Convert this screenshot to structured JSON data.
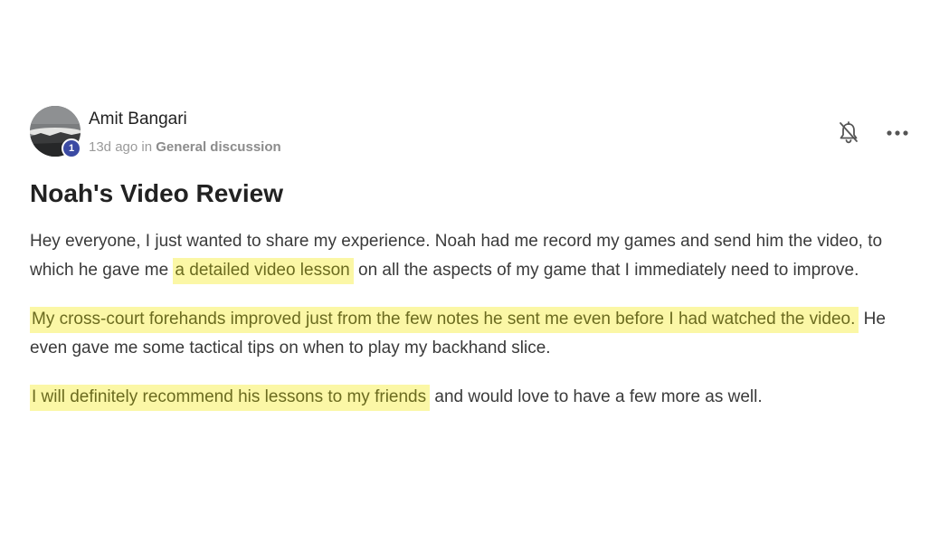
{
  "post": {
    "author": "Amit Bangari",
    "badge_count": "1",
    "time_ago": "13d ago",
    "in_text": "in",
    "category": "General discussion",
    "title": "Noah's Video Review",
    "paragraph1": {
      "part1": "Hey everyone, I just wanted to share my experience. Noah had me record my games and send him the video, to which he gave me ",
      "highlight": "a detailed video lesson",
      "part2": " on all the aspects of my game that I immediately need to improve."
    },
    "paragraph2": {
      "highlight": "My cross-court forehands improved just from the few notes he sent me even before I had watched the video.",
      "part2": " He even gave me some tactical tips on when to play my backhand slice."
    },
    "paragraph3": {
      "highlight": "I will definitely recommend his lessons to my friends",
      "part2": " and would love to have a few more as well."
    }
  },
  "icons": {
    "notifications": "bell-off-icon",
    "more": "more-dots-icon"
  },
  "colors": {
    "highlight_bg": "#fbf7a6",
    "highlight_text": "#6b6b1f",
    "badge": "#3b4aa3"
  }
}
